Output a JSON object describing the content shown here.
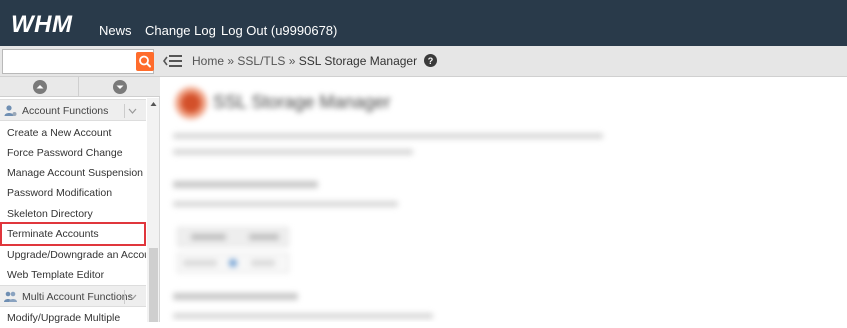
{
  "brand": {
    "logo": "WHM"
  },
  "topnav": [
    {
      "label": "News"
    },
    {
      "label": "Change Log"
    },
    {
      "label": "Log Out (u9990678)"
    }
  ],
  "search": {
    "value": "",
    "placeholder": ""
  },
  "breadcrumb": {
    "home": "Home",
    "sep": "»",
    "section": "SSL/TLS",
    "current": "SSL Storage Manager"
  },
  "sidebar": {
    "sections": [
      {
        "label": "Account Functions",
        "items": [
          {
            "label": "Create a New Account"
          },
          {
            "label": "Force Password Change"
          },
          {
            "label": "Manage Account Suspension"
          },
          {
            "label": "Password Modification"
          },
          {
            "label": "Skeleton Directory"
          },
          {
            "label": "Terminate Accounts",
            "highlighted": true
          },
          {
            "label": "Upgrade/Downgrade an Account"
          },
          {
            "label": "Web Template Editor"
          }
        ]
      },
      {
        "label": "Multi Account Functions",
        "items": [
          {
            "label": "Modify/Upgrade Multiple"
          }
        ]
      }
    ]
  },
  "main": {
    "title": "SSL Storage Manager"
  },
  "colors": {
    "topbar": "#293a4a",
    "accent": "#ff6c2c",
    "highlight_border": "#e0363c"
  }
}
